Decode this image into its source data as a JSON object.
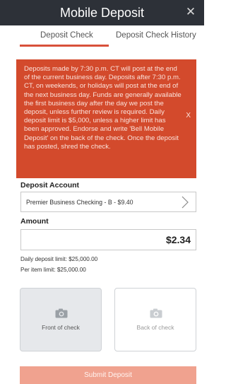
{
  "header": {
    "title": "Mobile Deposit",
    "close_glyph": "✕"
  },
  "tabs": [
    {
      "label": "Deposit Check",
      "active": true
    },
    {
      "label": "Deposit Check History",
      "active": false
    }
  ],
  "notice": {
    "text": "Deposits made by 7:30 p.m. CT will post at the end of the current business day. Deposits after 7:30 p.m. CT, on weekends, or holidays will post at the end of the next business day. Funds are generally available the first business day after the day we post the deposit, unless further review is required. Daily deposit limit is $5,000, unless a higher limit has been approved. Endorse and write 'Bell Mobile Deposit' on the back of the check. Once the deposit has posted, shred the check.",
    "close_label": "X"
  },
  "deposit_account": {
    "label": "Deposit Account",
    "value": "Premier Business Checking - B - $9.40"
  },
  "amount": {
    "label": "Amount",
    "value": "$2.34"
  },
  "limits": {
    "daily": "Daily deposit limit: $25,000.00",
    "per_item": "Per item limit: $25,000.00"
  },
  "check_images": {
    "front_label": "Front of check",
    "back_label": "Back of check"
  },
  "submit_label": "Submit Deposit",
  "colors": {
    "header_bg": "#2d3138",
    "accent": "#d8503a",
    "notice_bg": "#d34a2c",
    "submit_disabled": "#f0a28f"
  },
  "icons": {
    "close": "close-icon",
    "chevron": "chevron-right-icon",
    "camera": "camera-icon"
  }
}
